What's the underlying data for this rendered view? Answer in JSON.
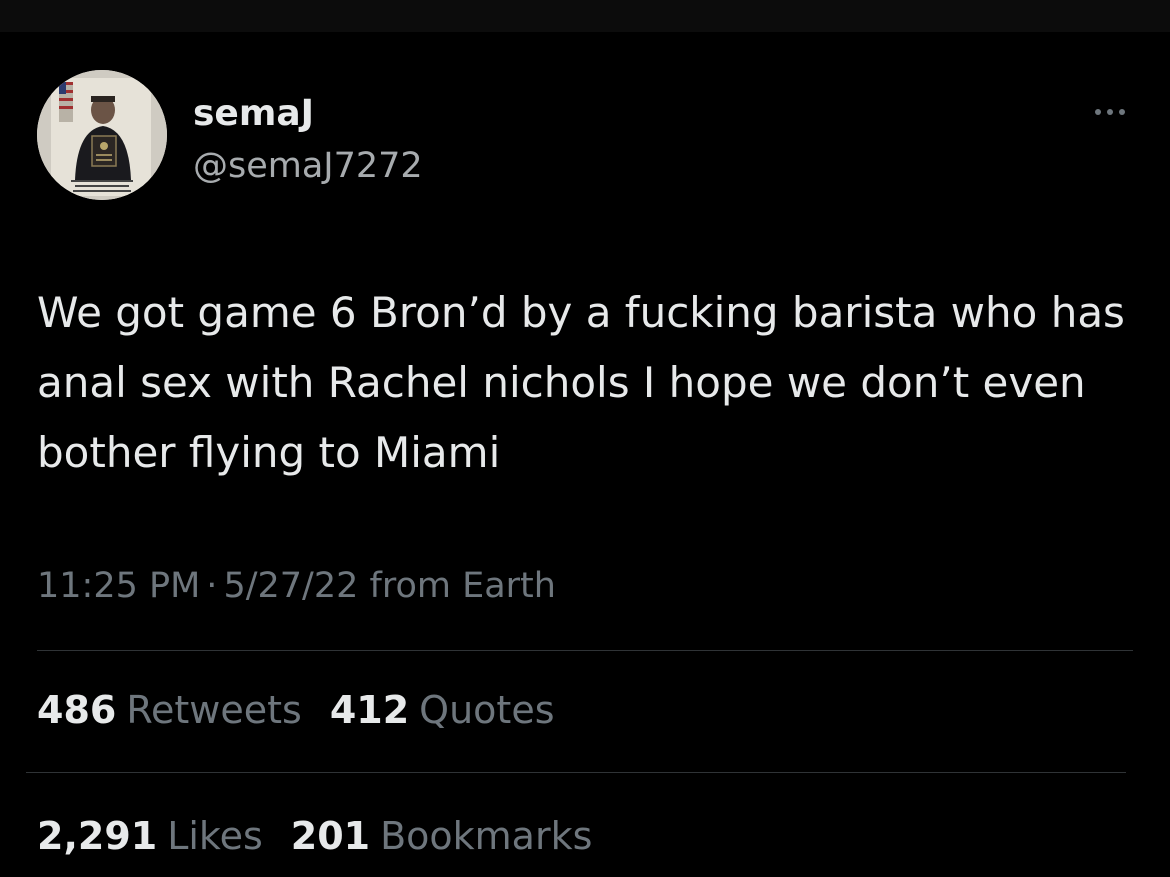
{
  "tweet": {
    "display_name": "semaJ",
    "handle": "@semaJ7272",
    "more_icon": "more-horizontal-icon",
    "text": "We got game 6 Bron’d by a fucking barista who has anal sex with Rachel nichols I hope we don’t even bother flying to Miami",
    "time": "11:25 PM",
    "date": "5/27/22",
    "source": "from Earth",
    "separator": "·"
  },
  "stats": {
    "retweets": {
      "count": "486",
      "label": "Retweets"
    },
    "quotes": {
      "count": "412",
      "label": "Quotes"
    },
    "likes": {
      "count": "2,291",
      "label": "Likes"
    },
    "bookmarks": {
      "count": "201",
      "label": "Bookmarks"
    }
  },
  "colors": {
    "background": "#000000",
    "text_primary": "#e7e9ea",
    "text_secondary": "#6e767d",
    "divider": "#2f3336"
  }
}
